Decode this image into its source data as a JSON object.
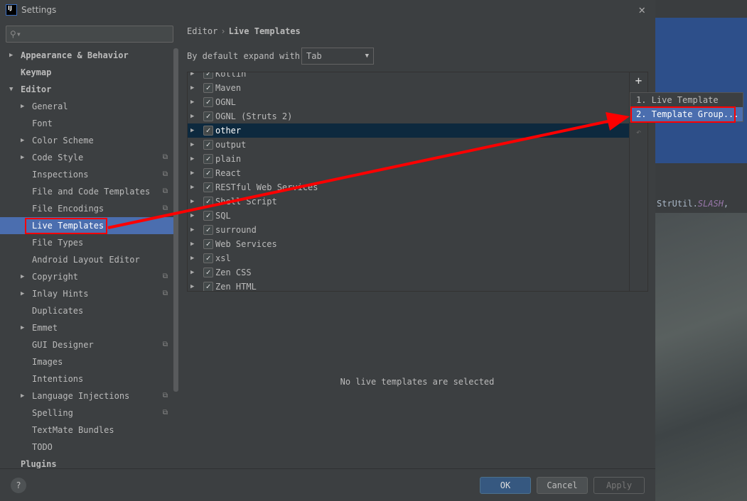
{
  "background_window": {
    "code_text": "StrUtil.",
    "code_constant": "SLASH",
    "code_tail": ","
  },
  "window": {
    "title": "Settings",
    "logo": "IJ"
  },
  "sidebar": {
    "search_placeholder": "",
    "items": [
      {
        "label": "Appearance & Behavior",
        "level": 0,
        "arrow": "right",
        "bold": true
      },
      {
        "label": "Keymap",
        "level": 0,
        "bold": true
      },
      {
        "label": "Editor",
        "level": 0,
        "arrow": "down",
        "bold": true
      },
      {
        "label": "General",
        "level": 1,
        "arrow": "right"
      },
      {
        "label": "Font",
        "level": 1
      },
      {
        "label": "Color Scheme",
        "level": 1,
        "arrow": "right"
      },
      {
        "label": "Code Style",
        "level": 1,
        "arrow": "right",
        "copy": true
      },
      {
        "label": "Inspections",
        "level": 1,
        "copy": true
      },
      {
        "label": "File and Code Templates",
        "level": 1,
        "copy": true
      },
      {
        "label": "File Encodings",
        "level": 1,
        "copy": true
      },
      {
        "label": "Live Templates",
        "level": 1,
        "selected": true
      },
      {
        "label": "File Types",
        "level": 1
      },
      {
        "label": "Android Layout Editor",
        "level": 1
      },
      {
        "label": "Copyright",
        "level": 1,
        "arrow": "right",
        "copy": true
      },
      {
        "label": "Inlay Hints",
        "level": 1,
        "arrow": "right",
        "copy": true
      },
      {
        "label": "Duplicates",
        "level": 1
      },
      {
        "label": "Emmet",
        "level": 1,
        "arrow": "right"
      },
      {
        "label": "GUI Designer",
        "level": 1,
        "copy": true
      },
      {
        "label": "Images",
        "level": 1
      },
      {
        "label": "Intentions",
        "level": 1
      },
      {
        "label": "Language Injections",
        "level": 1,
        "arrow": "right",
        "copy": true
      },
      {
        "label": "Spelling",
        "level": 1,
        "copy": true
      },
      {
        "label": "TextMate Bundles",
        "level": 1
      },
      {
        "label": "TODO",
        "level": 1
      },
      {
        "label": "Plugins",
        "level": 0,
        "bold": true
      }
    ]
  },
  "main": {
    "breadcrumb": [
      "Editor",
      "Live Templates"
    ],
    "expand_label": "By default expand with",
    "expand_value": "Tab",
    "groups": [
      {
        "label": "Kotlin",
        "checked": true
      },
      {
        "label": "Maven",
        "checked": true
      },
      {
        "label": "OGNL",
        "checked": true
      },
      {
        "label": "OGNL (Struts 2)",
        "checked": true
      },
      {
        "label": "other",
        "checked": true,
        "selected": true
      },
      {
        "label": "output",
        "checked": true
      },
      {
        "label": "plain",
        "checked": true
      },
      {
        "label": "React",
        "checked": true
      },
      {
        "label": "RESTful Web Services",
        "checked": true
      },
      {
        "label": "Shell Script",
        "checked": true
      },
      {
        "label": "SQL",
        "checked": true
      },
      {
        "label": "surround",
        "checked": true
      },
      {
        "label": "Web Services",
        "checked": true
      },
      {
        "label": "xsl",
        "checked": true
      },
      {
        "label": "Zen CSS",
        "checked": true
      },
      {
        "label": "Zen HTML",
        "checked": true
      }
    ],
    "toolbar": {
      "add": "+",
      "remove": "−",
      "copy": "⧉",
      "undo": "↶"
    },
    "empty_text": "No live templates are selected"
  },
  "popup": {
    "items": [
      "1. Live Template",
      "2. Template Group..."
    ],
    "selected": 1
  },
  "footer": {
    "help": "?",
    "ok": "OK",
    "cancel": "Cancel",
    "apply": "Apply"
  },
  "annotation_color": "#ff0000",
  "selection_color": "#4b6eaf"
}
